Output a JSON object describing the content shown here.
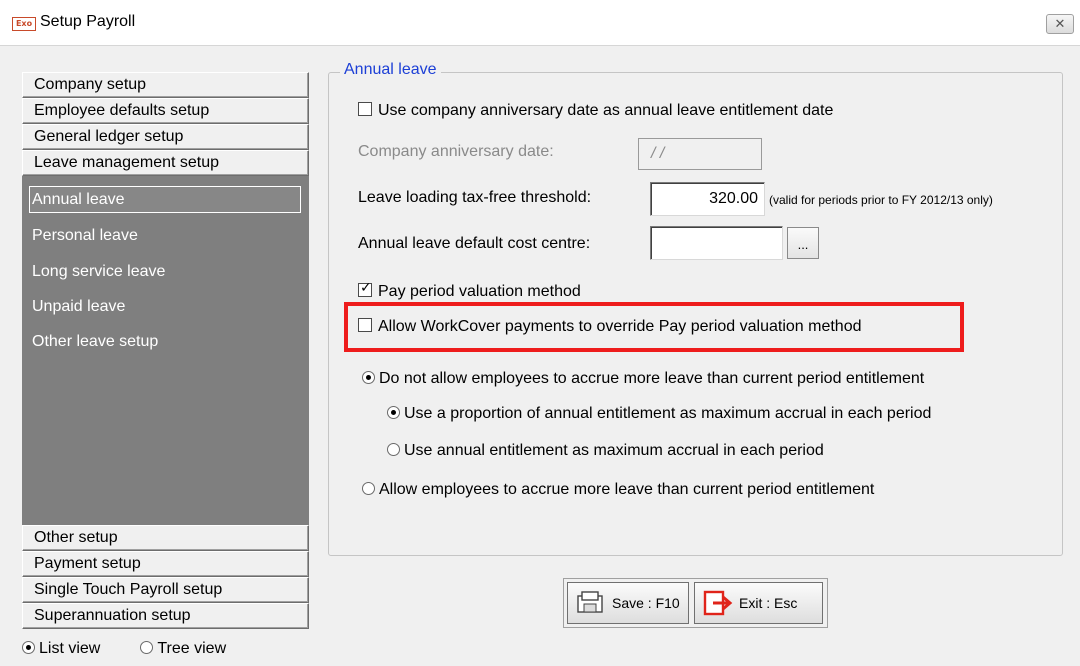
{
  "window": {
    "title": "Setup Payroll",
    "icon_text": "Exo",
    "close_symbol": "✕"
  },
  "sidebar": {
    "top_sections": [
      "Company setup",
      "Employee defaults setup",
      "General ledger setup",
      "Leave management setup"
    ],
    "panel_items": [
      "Annual leave",
      "Personal leave",
      "Long service leave",
      "Unpaid leave",
      "Other leave setup"
    ],
    "selected_item": "Annual leave",
    "bottom_sections": [
      "Other setup",
      "Payment setup",
      "Single Touch Payroll setup",
      "Superannuation setup"
    ]
  },
  "view_options": {
    "list_view": "List view",
    "tree_view": "Tree view",
    "selected": "List view"
  },
  "annual_leave": {
    "group_title": "Annual leave",
    "use_company_anniversary": {
      "label": "Use company anniversary date as annual leave entitlement date",
      "checked": false
    },
    "company_anniversary_date": {
      "label": "Company anniversary date:",
      "value": "/ /"
    },
    "tax_free_threshold": {
      "label": "Leave loading tax-free threshold:",
      "value": "320.00",
      "note": "(valid for periods prior to FY 2012/13 only)"
    },
    "default_cost_centre": {
      "label": "Annual leave default cost centre:",
      "value": "",
      "browse_label": "..."
    },
    "pay_period_valuation": {
      "label": "Pay period valuation method",
      "checked": true
    },
    "workcover_override": {
      "label": "Allow WorkCover payments to override Pay period valuation method",
      "checked": false
    },
    "accrual_no_more": {
      "label": "Do not allow employees to accrue more leave than current period entitlement",
      "selected": true
    },
    "accrual_proportion": {
      "label": "Use a proportion of annual entitlement as maximum accrual in each period",
      "selected": true
    },
    "accrual_annual": {
      "label": "Use annual entitlement as maximum accrual in each period",
      "selected": false
    },
    "accrual_allow_more": {
      "label": "Allow employees to accrue more leave than current period entitlement",
      "selected": false
    }
  },
  "buttons": {
    "save": "Save : F10",
    "exit": "Exit : Esc"
  },
  "colors": {
    "highlight": "#ee1c1c",
    "group_title": "#1c3fd6",
    "sidebar_panel": "#7f7f7f"
  }
}
